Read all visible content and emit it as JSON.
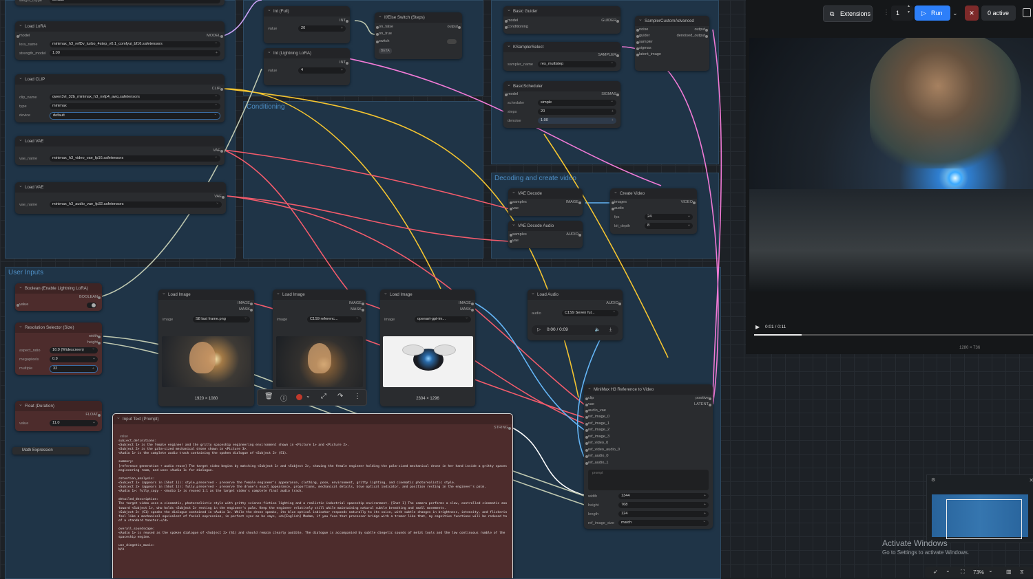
{
  "toolbar": {
    "extensions_label": "Extensions",
    "run_count": "1",
    "run_label": "Run",
    "active_label": "0 active"
  },
  "groups": {
    "conditioning": "Conditioning",
    "decoding": "Decoding and create video",
    "user_inputs": "User Inputs"
  },
  "nodes": {
    "top_partial": {
      "label": "weight_dtype",
      "value": "default"
    },
    "load_lora": {
      "title": "Load LoRA",
      "in_model": "model",
      "out_model": "MODEL",
      "lora_name_label": "lora_name",
      "lora_name": "minimax_h3_refDv_turbo_4step_v0.1_comfyui_bf16.safetensors",
      "strength_label": "strength_model",
      "strength": "1.00"
    },
    "load_clip": {
      "title": "Load CLIP",
      "out": "CLIP",
      "clip_name_label": "clip_name",
      "clip_name": "qwen3vl_32b_minimax_h3_nvfp4_awq.safetensors",
      "type_label": "type",
      "type": "minimax",
      "device_label": "device",
      "device": "default"
    },
    "load_vae1": {
      "title": "Load VAE",
      "out": "VAE",
      "vae_name_label": "vae_name",
      "vae_name": "minimax_h3_video_vae_fp16.safetensors"
    },
    "load_vae2": {
      "title": "Load VAE",
      "out": "VAE",
      "vae_name_label": "vae_name",
      "vae_name": "minimax_h3_audio_vae_fp32.safetensors"
    },
    "int_full": {
      "title": "Int (Full)",
      "out": "INT",
      "value_label": "value",
      "value": "20"
    },
    "int_lightning": {
      "title": "Int (Lightning LoRA)",
      "out": "INT",
      "value_label": "value",
      "value": "4"
    },
    "ifelse": {
      "title": "If/Else Switch (Steps)",
      "in_false": "on_false",
      "in_true": "on_true",
      "in_switch": "switch",
      "out": "output",
      "beta": "BETA"
    },
    "basic_guider": {
      "title": "Basic Guider",
      "in_model": "model",
      "in_cond": "conditioning",
      "out": "GUIDER"
    },
    "ksampler_select": {
      "title": "KSamplerSelect",
      "out": "SAMPLER",
      "label": "sampler_name",
      "value": "res_multistep"
    },
    "basic_scheduler": {
      "title": "BasicScheduler",
      "in_model": "model",
      "out": "SIGMAS",
      "scheduler_label": "scheduler",
      "scheduler": "simple",
      "steps_label": "steps",
      "steps": "20",
      "denoise_label": "denoise",
      "denoise": "1.00"
    },
    "sampler_custom": {
      "title": "SamplerCustomAdvanced",
      "in_noise": "noise",
      "in_guider": "guider",
      "in_sampler": "sampler",
      "in_sigmas": "sigmas",
      "in_latent": "latent_image",
      "out_output": "output",
      "out_denoised": "denoised_output"
    },
    "vae_decode": {
      "title": "VAE Decode",
      "in_samples": "samples",
      "in_vae": "vae",
      "out": "IMAGE"
    },
    "vae_decode_audio": {
      "title": "VAE Decode Audio",
      "in_samples": "samples",
      "in_vae": "vae",
      "out": "AUDIO"
    },
    "create_video": {
      "title": "Create Video",
      "in_images": "images",
      "in_audio": "audio",
      "out": "VIDEO",
      "fps_label": "fps",
      "fps": "24",
      "bit_label": "bit_depth",
      "bit": "8"
    },
    "boolean": {
      "title": "Boolean (Enable Lightning LoRA)",
      "out": "BOOLEAN",
      "value_label": "value"
    },
    "resolution": {
      "title": "Resolution Selector (Size)",
      "out_width": "width",
      "out_height": "height",
      "aspect_label": "aspect_ratio",
      "aspect": "16:9 (Widescreen)",
      "mp_label": "megapixels",
      "mp": "0.9",
      "mult_label": "multiple",
      "mult": "32"
    },
    "float_duration": {
      "title": "Float (Duration)",
      "out": "FLOAT",
      "value_label": "value",
      "value": "11.0"
    },
    "math_expr": {
      "title": "Math Expression"
    },
    "load_image1": {
      "title": "Load Image",
      "out_image": "IMAGE",
      "out_mask": "MASK",
      "image_label": "image",
      "file": "S8 last frame.png",
      "size": "1920 × 1080"
    },
    "load_image2": {
      "title": "Load Image",
      "out_image": "IMAGE",
      "out_mask": "MASK",
      "image_label": "image",
      "file": "C1S9 referenc...",
      "size": ""
    },
    "load_image3": {
      "title": "Load Image",
      "out_image": "IMAGE",
      "out_mask": "MASK",
      "image_label": "image",
      "file": "openart-gpt-im...",
      "size": "2304 × 1296"
    },
    "load_audio": {
      "title": "Load Audio",
      "out": "AUDIO",
      "audio_label": "audio",
      "file": "C1S9 Seven ful...",
      "time": "0:00 / 0:09"
    },
    "minimax_ref": {
      "title": "MiniMax H3 Reference to Video",
      "in_clip": "clip",
      "in_vae": "vae",
      "in_audio_vae": "audio_vae",
      "in_ref_image_0": "ref_image_0",
      "in_ref_image_1": "ref_image_1",
      "in_ref_image_2": "ref_image_2",
      "in_ref_image_3": "ref_image_3",
      "in_ref_video_0": "ref_video_0",
      "in_ref_video_audio_0": "ref_video_audio_0",
      "in_ref_audio_0": "ref_audio_0",
      "in_ref_audio_1": "ref_audio_1",
      "out_positive": "positive",
      "out_latent": "LATENT",
      "prompt_placeholder": "prompt",
      "width_label": "width",
      "width": "1344",
      "height_label": "height",
      "height": "768",
      "length_label": "length",
      "length": "124",
      "ref_size_label": "ref_image_size",
      "ref_size": "match"
    },
    "input_text": {
      "title": "Input Text (Prompt)",
      "out": "STRING",
      "value_label": "value"
    }
  },
  "prompt_text": "subject_definitions:\n<Subject 1> is the female engineer and the gritty spaceship engineering environment shown in <Picture 1> and <Picture 2>.\n<Subject 2> is the palm-sized mechanical drone shown in <Picture 3>.\n<Audio 1> is the complete audio track containing the spoken dialogue of <Subject 2> (S1).\n\nsummary:\n[reference generation + audio reuse] The target video begins by matching <Subject 1> and <Subject 2>, showing the female engineer holding the palm-sized mechanical drone in her hand inside a gritty spaceship\nengineering room, and uses <Audio 1> for dialogue.\n\nretention_analysis:\n<Subject 1> (appears in [Shot 1]): style_preserved - preserve the female engineer's appearance, clothing, pose, environment, gritty lighting, and cinematic photorealistic style.\n<Subject 2> (appears in [Shot 1]): fully_preserved - preserve the drone's exact appearance, proportions, mechanical details, blue optical indicator, and position resting in the engineer's palm.\n<Audio 1>: fully_copy - <Audio 1> is reused 1:1 as the target video's complete final audio track.\n\ndetailed_description:\nThe target video uses a cinematic, photorealistic style with gritty science-fiction lighting and a realistic industrial spaceship environment. [Shot 1] The camera performs a slow, controlled cinematic zoom\ntoward <Subject 1>, who holds <Subject 2> resting in the engineer's palm. Keep the engineer relatively still while maintaining natural subtle breathing and small movements.\n<Subject 2> (S1) speaks the dialogue contained in <Audio 1>. While the drone speaks, its blue optical indicator responds naturally to its voice, with subtle changes in brightness, intensity, and flickering that\nfeel like a mechanical equivalent of facial expression, in perfect sync as he says, <d>[English] Madam, if you fuse that processor bridge with a tremor like that, my cognitive functions will be reduced to that\nof a standard toaster.</d>\n\noverall_soundscape:\n<Audio 1> is reused as the spoken dialogue of <Subject 2> (S1) and should remain clearly audible. The dialogue is accompanied by subtle diegetic sounds of metal tools and the low continuous rumble of the\nspaceship engine.\n\nuse_diegetic_music:\nN/A",
  "preview": {
    "time": "0:01 / 0:11",
    "dims": "1280 × 736"
  },
  "activate": {
    "title": "Activate Windows",
    "subtitle": "Go to Settings to activate Windows."
  },
  "zoom": "73%",
  "colors": {
    "accent": "#2d7ff9",
    "clip_wire": "#f4c430",
    "vae_wire": "#f25b6b",
    "latent_wire": "#f07ad6",
    "image_wire": "#64b5f6",
    "model_wire": "#c9a2f5"
  }
}
